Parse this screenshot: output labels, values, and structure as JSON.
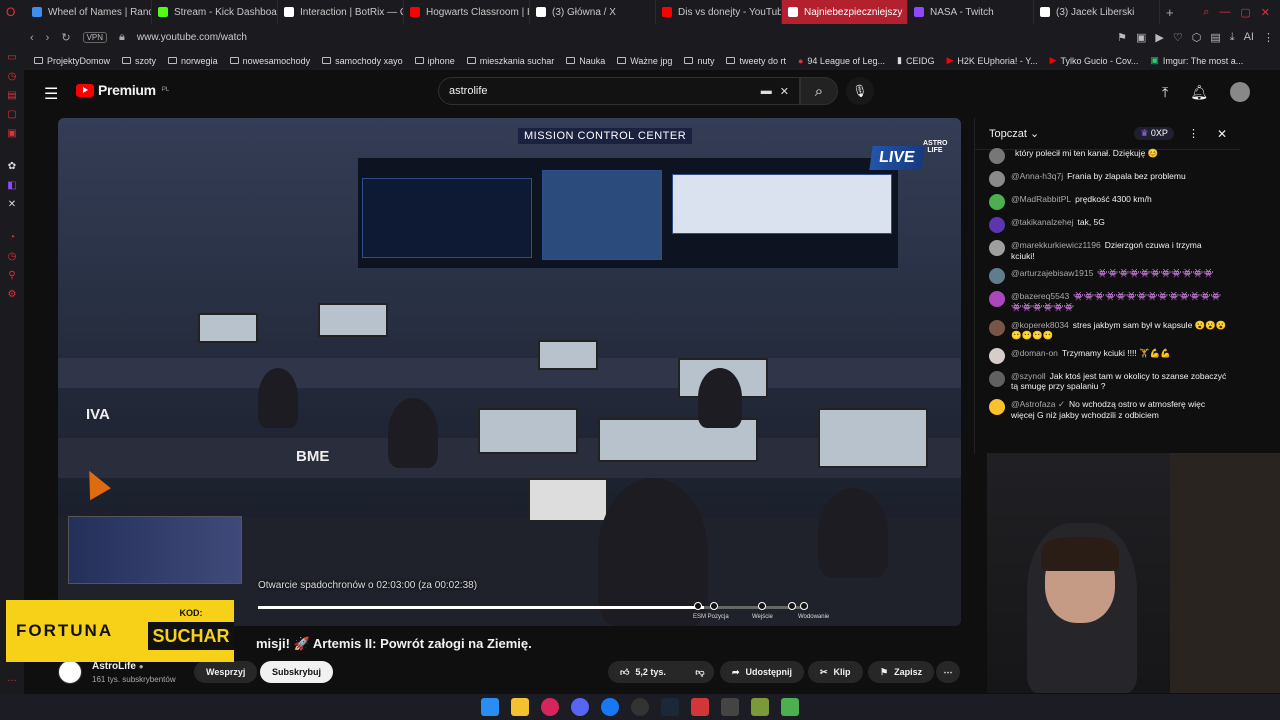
{
  "browser": {
    "tabs": [
      {
        "label": "Wheel of Names | Rando",
        "color": "#3d8ef0"
      },
      {
        "label": "Stream - Kick Dashboard",
        "color": "#53fc18"
      },
      {
        "label": "Interaction | BotRix — Cl",
        "color": "#ffffff"
      },
      {
        "label": "Hogwarts Classroom | Ha",
        "color": "#ff0000"
      },
      {
        "label": "(3) Główna / X",
        "color": "#ffffff"
      },
      {
        "label": "Dis vs donejty - YouTube",
        "color": "#ff0000"
      },
      {
        "label": "Najniebezpieczniejszy",
        "color": "#ffffff"
      },
      {
        "label": "NASA - Twitch",
        "color": "#9146ff"
      },
      {
        "label": "(3) Jacek Liberski",
        "color": "#ffffff"
      }
    ],
    "url": "www.youtube.com/watch",
    "vpn_label": "VPN",
    "ai_label": "AI",
    "bookmarks": [
      "ProjektyDomow",
      "szoty",
      "norwegia",
      "nowesamochody",
      "samochody xayo",
      "iphone",
      "mieszkania suchar",
      "Nauka",
      "Ważne jpg",
      "nuty",
      "tweety do rt",
      "94 League of Leg...",
      "CEIDG",
      "H2K EUphoria! - Y...",
      "Tylko Gucio - Cov...",
      "Imgur: The most a..."
    ]
  },
  "youtube": {
    "logo_text": "Premium",
    "logo_region": "PL",
    "search_value": "astrolife",
    "video": {
      "live_label": "LIVE",
      "astro_badge": "ASTRO LIFE",
      "mcc_sign": "MISSION CONTROL CENTER",
      "bme_label": "BME",
      "iva_label": "IVA",
      "caption": "Otwarcie spadochronów o 02:03:00 (za 00:02:38)",
      "progress_fraction": 0.81,
      "chapters": [
        "ESM Pozycja",
        "Wejście",
        "Wodowanie"
      ],
      "title": "misji! 🚀 Artemis II: Powrót załogi na Ziemię."
    },
    "sponsor": {
      "brand": "FORTUNA",
      "code_label": "KOD:",
      "code": "SUCHAR"
    },
    "channel": {
      "name": "AstroLife",
      "subscribers": "161 tys. subskrybentów"
    },
    "buttons": {
      "support": "Wesprzyj",
      "subscribe": "Subskrybuj",
      "likes": "5,2 tys.",
      "share": "Udostępnij",
      "clip": "Klip",
      "save": "Zapisz"
    }
  },
  "chat": {
    "header": "Topczat",
    "xp": "0XP",
    "messages": [
      {
        "user": "",
        "text": "który polecił mi ten kanał. Dziękuję 😊",
        "color": "#777"
      },
      {
        "user": "@Anna-h3q7j",
        "text": "Frania by zlapala bez problemu",
        "color": "#8a8a8a"
      },
      {
        "user": "@MadRabbitPL",
        "text": "prędkość 4300 km/h",
        "color": "#4caf50"
      },
      {
        "user": "@takikanalzehej",
        "text": "tak, 5G",
        "color": "#5e35b1"
      },
      {
        "user": "@marekkurkiewicz1196",
        "text": "Dzierzgoń czuwa i trzyma kciuki!",
        "color": "#9e9e9e"
      },
      {
        "user": "@arturzajebisaw1915",
        "text": "👾👾👾👾👾👾👾👾👾👾👾",
        "color": "#607d8b"
      },
      {
        "user": "@bazereq5543",
        "text": "👾👾👾👾👾👾👾👾👾👾👾👾👾👾👾👾👾👾👾👾",
        "color": "#ab47bc"
      },
      {
        "user": "@koperek8034",
        "text": "stres jakbym sam był w kapsule 😮😮😮😶😶😶😶",
        "color": "#795548"
      },
      {
        "user": "@doman-on",
        "text": "Trzymamy kciuki !!!! 🏋💪💪",
        "color": "#d7ccc8"
      },
      {
        "user": "@szynoll",
        "text": "Jak ktoś jest tam w okolicy to szanse zobaczyć tą smugę przy spalaniu ?",
        "color": "#616161"
      },
      {
        "user": "@Astrofaza ✓",
        "text": "No wchodzą ostro w atmosferę więc więcej G niż jakby wchodzili z odbiciem",
        "color": "#fbc02d"
      }
    ]
  }
}
